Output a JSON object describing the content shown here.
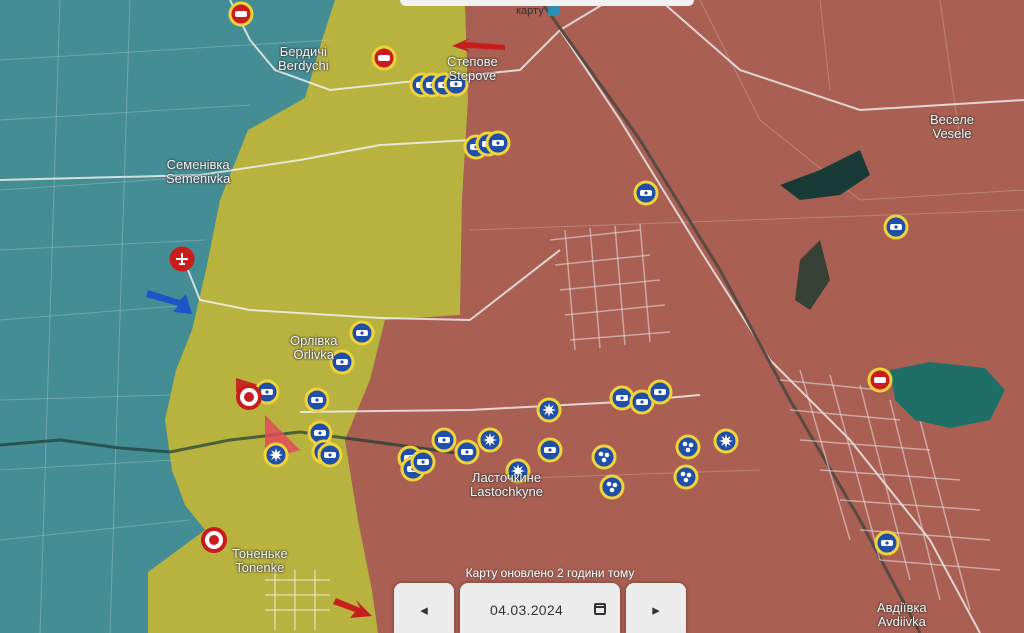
{
  "header": {
    "map_tab_label": "карту",
    "map_tab_icon": "book-icon"
  },
  "places": [
    {
      "id": "berdychi",
      "uk": "Бердичі",
      "en": "Berdychi"
    },
    {
      "id": "stepove",
      "uk": "Степове",
      "en": "Stepove"
    },
    {
      "id": "semenivka",
      "uk": "Семенівка",
      "en": "Semenivka"
    },
    {
      "id": "orlivka",
      "uk": "Орлівка",
      "en": "Orlivka"
    },
    {
      "id": "lastochkyne",
      "uk": "Ласточкине",
      "en": "Lastochkyne"
    },
    {
      "id": "tonenke",
      "uk": "Тоненьке",
      "en": "Tonenke"
    },
    {
      "id": "vesele",
      "uk": "Веселе",
      "en": "Vesele"
    },
    {
      "id": "avdiivka",
      "uk": "Авдіївка",
      "en": "Avdiivka"
    }
  ],
  "footer": {
    "updated_text": "Карту оновлено 2 години тому",
    "date_value": "04.03.2024",
    "prev_label": "◂",
    "next_label": "▸"
  },
  "colors": {
    "ukrainian_control": "#3f8f9a",
    "contested": "#c9c236",
    "russian_control": "#b35a50",
    "marker_blue": "#1f4fa8",
    "marker_ring": "#f0d23a",
    "attack_red": "#c81d1d",
    "attack_blue": "#1b56c7"
  },
  "icons": [
    "airfield-icon",
    "unit-marker-icon",
    "explosion-marker-icon",
    "red-target-icon",
    "attack-arrow-icon",
    "calendar-icon"
  ]
}
